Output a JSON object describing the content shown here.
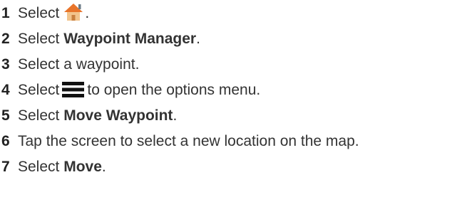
{
  "steps": [
    {
      "number": "1",
      "parts": {
        "before": "Select",
        "after": "."
      },
      "icon": "home-icon"
    },
    {
      "number": "2",
      "parts": {
        "before": "Select ",
        "bold": "Waypoint Manager",
        "after": "."
      }
    },
    {
      "number": "3",
      "parts": {
        "text": "Select a waypoint."
      }
    },
    {
      "number": "4",
      "parts": {
        "before": "Select",
        "after": "to open the options menu."
      },
      "icon": "menu-icon"
    },
    {
      "number": "5",
      "parts": {
        "before": "Select ",
        "bold": "Move Waypoint",
        "after": "."
      }
    },
    {
      "number": "6",
      "parts": {
        "text": "Tap the screen to select a new location on the map."
      }
    },
    {
      "number": "7",
      "parts": {
        "before": "Select ",
        "bold": "Move",
        "after": "."
      }
    }
  ],
  "colors": {
    "text": "#333333",
    "number": "#222222",
    "house_roof": "#e8742a",
    "house_body": "#f2c48c",
    "house_door": "#c9813f",
    "menu_bars": "#111111"
  }
}
